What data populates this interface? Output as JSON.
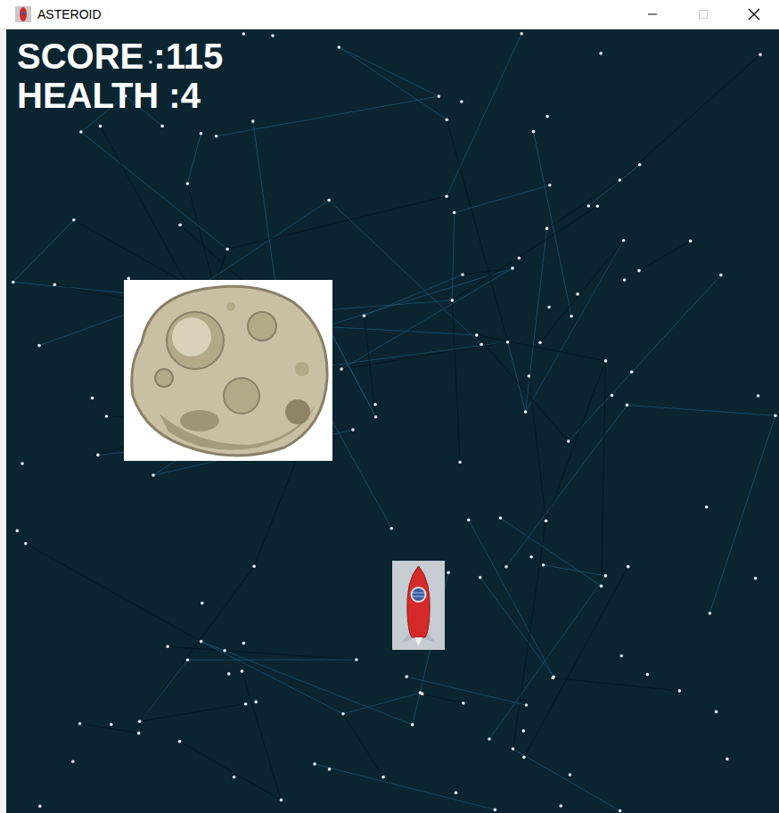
{
  "window": {
    "title": "ASTEROID"
  },
  "hud": {
    "score": "SCORE :115",
    "health": "HEALTH :4"
  }
}
